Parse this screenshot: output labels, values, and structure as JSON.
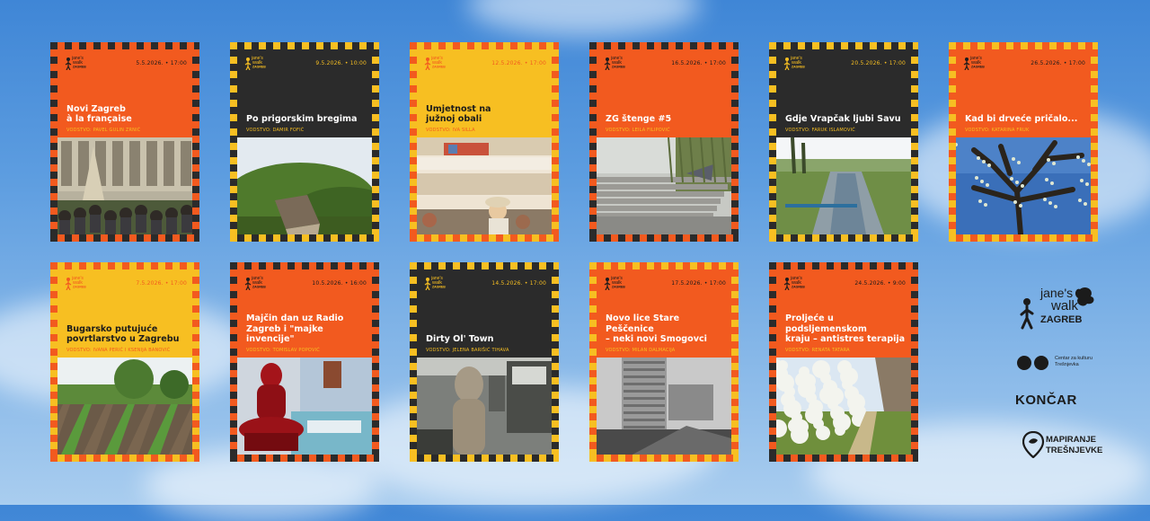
{
  "colors": {
    "orange": "#f25a1f",
    "dark": "#2b2b2b",
    "yellow": "#f7bf22"
  },
  "cards": [
    {
      "date": "5.5.2026.  •  17:00",
      "title": "Novi Zagreb<br>à la française",
      "leader": "VODSTVO: PAVEL GULIN ZRNIĆ",
      "head": "orange",
      "border": "dark",
      "photo": "facade"
    },
    {
      "date": "9.5.2026.  •  10:00",
      "title": "Po prigorskim bregima",
      "leader": "VODSTVO: DAMIR FOFIĆ",
      "head": "dark",
      "border": "yellow",
      "photo": "hill"
    },
    {
      "date": "12.5.2026.  •  17:00",
      "title": "Umjetnost na<br>južnoj obali",
      "leader": "VODSTVO: IVA SILLA",
      "head": "yellow",
      "border": "orange",
      "photo": "balcony"
    },
    {
      "date": "16.5.2026.  •  17:00",
      "title": "ZG štenge #5",
      "leader": "VODSTVO: LEILA FILIPOVIĆ",
      "head": "orange",
      "border": "dark",
      "photo": "steps"
    },
    {
      "date": "20.5.2026.  •  17:00",
      "title": "Gdje Vrapčak ljubi Savu",
      "leader": "VODSTVO: FARUK ISLAMOVIĆ",
      "head": "dark",
      "border": "yellow",
      "photo": "river"
    },
    {
      "date": "26.5.2026.  •  17:00",
      "title": "Kad bi drveće pričalo...",
      "leader": "VODSTVO: KATARINA FRUK",
      "head": "orange",
      "border": "yellow",
      "photo": "tree"
    },
    {
      "date": "7.5.2026.  •  17:00",
      "title": "Bugarsko putujuće<br>povrtlarstvo u Zagrebu",
      "leader": "VODSTVO: IVANA PERIĆ I KSENIJA BANOVIĆ",
      "head": "yellow",
      "border": "orange",
      "photo": "garden"
    },
    {
      "date": "10.5.2026.  •  16:00",
      "title": "Majčin dan uz Radio<br>Zagreb i \"majke invencije\"",
      "leader": "VODSTVO: TOMISLAV POPOVIĆ",
      "head": "orange",
      "border": "dark",
      "photo": "statue"
    },
    {
      "date": "14.5.2026.  •  17:00",
      "title": "Dirty Ol' Town",
      "leader": "VODSTVO: JELENA BARIŠIĆ TIHAVA",
      "head": "dark",
      "border": "yellow",
      "photo": "sculpture"
    },
    {
      "date": "17.5.2026.  •  17:00",
      "title": "Novo lice Stare Peščenice<br>– neki novi Smogovci",
      "leader": "VODSTVO: MILAN DALMACIJA",
      "head": "orange",
      "border": "yellow",
      "photo": "tower"
    },
    {
      "date": "24.5.2026.  •  9:00",
      "title": "Proljeće u podsljemenskom<br>kraju – antistres terapija",
      "leader": "VODSTVO: RENATA TATARA",
      "head": "orange",
      "border": "dark",
      "photo": "blossom"
    }
  ],
  "sponsors": {
    "janes_walk": {
      "line1": "jane's",
      "line2": "walk",
      "line3": "ZAGREB",
      "icon": "walking-person-icon"
    },
    "center": {
      "text": "Centar za kulturu Trešnjevka",
      "icon": "two-circles-logo"
    },
    "koncar": {
      "text": "KONČAR"
    },
    "mapiranje": {
      "line1": "MAPIRANJE",
      "line2": "TREŠNJEVKE",
      "icon": "map-pin-icon"
    }
  }
}
